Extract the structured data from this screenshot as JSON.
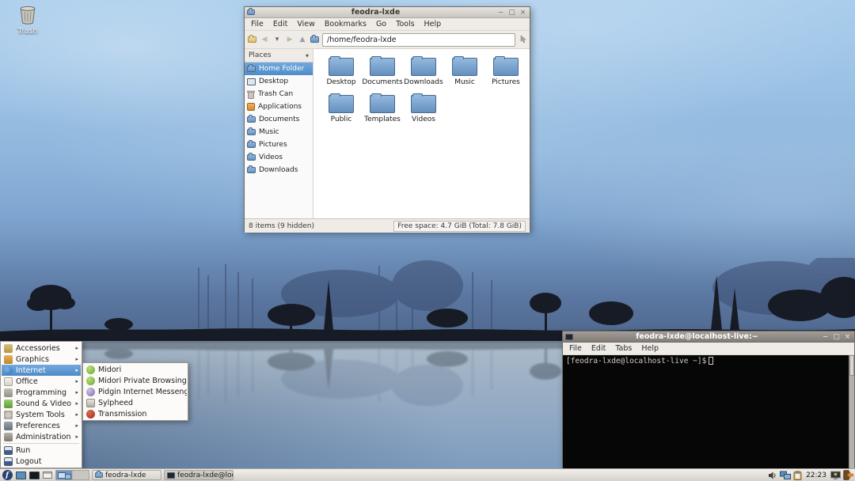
{
  "colors": {
    "selection": "#4e8cc8",
    "selection_light": "#72a9de",
    "window_chrome": "#efece7",
    "terminal_bg": "#060606",
    "terminal_fg": "#cfccc4",
    "fedora_blue": "#294172",
    "logout_orange": "#df8a2d",
    "folder_top": "#93b9de",
    "folder_bottom": "#6590bf"
  },
  "icons": {
    "minimize": "−",
    "maximize": "□",
    "close": "×",
    "back": "◀",
    "forward": "▶",
    "up": "▲",
    "dropdown": "▾",
    "submenu_arrow": "▸"
  },
  "desktop": {
    "trash_label": "Trash"
  },
  "file_manager": {
    "title": "feodra-lxde",
    "menu": [
      "File",
      "Edit",
      "View",
      "Bookmarks",
      "Go",
      "Tools",
      "Help"
    ],
    "address": "/home/feodra-lxde",
    "sidebar_header": "Places",
    "sidebar_items": [
      "Home Folder",
      "Desktop",
      "Trash Can",
      "Applications",
      "Documents",
      "Music",
      "Pictures",
      "Videos",
      "Downloads"
    ],
    "folders": [
      "Desktop",
      "Documents",
      "Downloads",
      "Music",
      "Pictures",
      "Public",
      "Templates",
      "Videos"
    ],
    "status_left": "8 items (9 hidden)",
    "status_right": "Free space: 4.7 GiB (Total: 7.8 GiB)"
  },
  "terminal": {
    "title": "feodra-lxde@localhost-live:~",
    "menu": [
      "File",
      "Edit",
      "Tabs",
      "Help"
    ],
    "prompt": "[feodra-lxde@localhost-live ~]$"
  },
  "start_menu": {
    "items": [
      "Accessories",
      "Graphics",
      "Internet",
      "Office",
      "Programming",
      "Sound & Video",
      "System Tools",
      "Preferences",
      "Administration",
      "Run",
      "Logout"
    ],
    "submenu_items": [
      "Midori",
      "Midori Private Browsing",
      "Pidgin Internet Messenger",
      "Sylpheed",
      "Transmission"
    ]
  },
  "taskbar": {
    "tasks": [
      "feodra-lxde",
      "feodra-lxde@loc..."
    ],
    "clock": "22:23"
  }
}
